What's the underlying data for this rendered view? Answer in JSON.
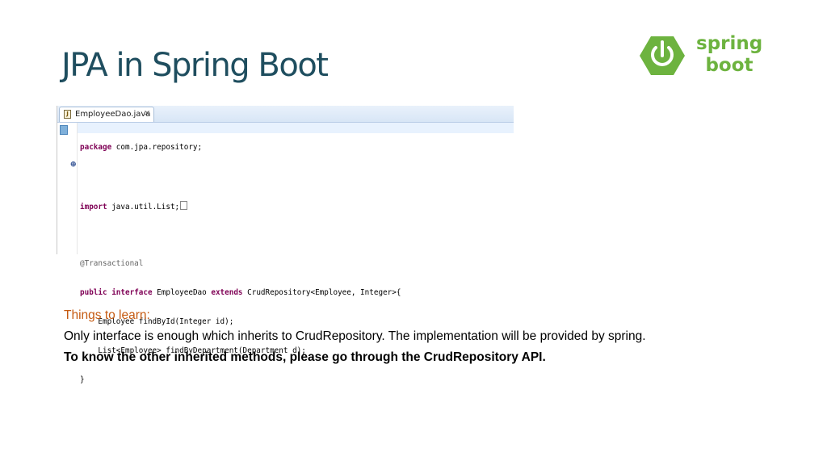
{
  "slide": {
    "title": "JPA in Spring Boot"
  },
  "logo": {
    "icon": "power-icon",
    "line1": "spring",
    "line2": "boot",
    "color": "#6db33f"
  },
  "editor": {
    "tab_label": "EmployeeDao.java",
    "file_icon_glyph": "J",
    "close_glyph": "⨯",
    "fold_glyph": "⊕",
    "code": {
      "package_kw": "package",
      "package_rest": " com.jpa.repository;",
      "import_kw": "import",
      "import_rest": " java.util.List;",
      "annotation": "@Transactional",
      "decl_kw1": "public",
      "decl_kw2": "interface",
      "decl_name": " EmployeeDao ",
      "decl_kw3": "extends",
      "decl_rest": " CrudRepository<Employee, Integer>{",
      "method1": "    Employee findById(Integer id);",
      "method2": "    List<Employee> findByDepartment(Department d);",
      "close_brace": "}"
    }
  },
  "notes": {
    "heading": "Things to learn:",
    "line1": "Only interface is enough which inherits to CrudRepository. The implementation will be provided by spring.",
    "line2": "To know the other inherited methods, please go through the CrudRepository API."
  }
}
